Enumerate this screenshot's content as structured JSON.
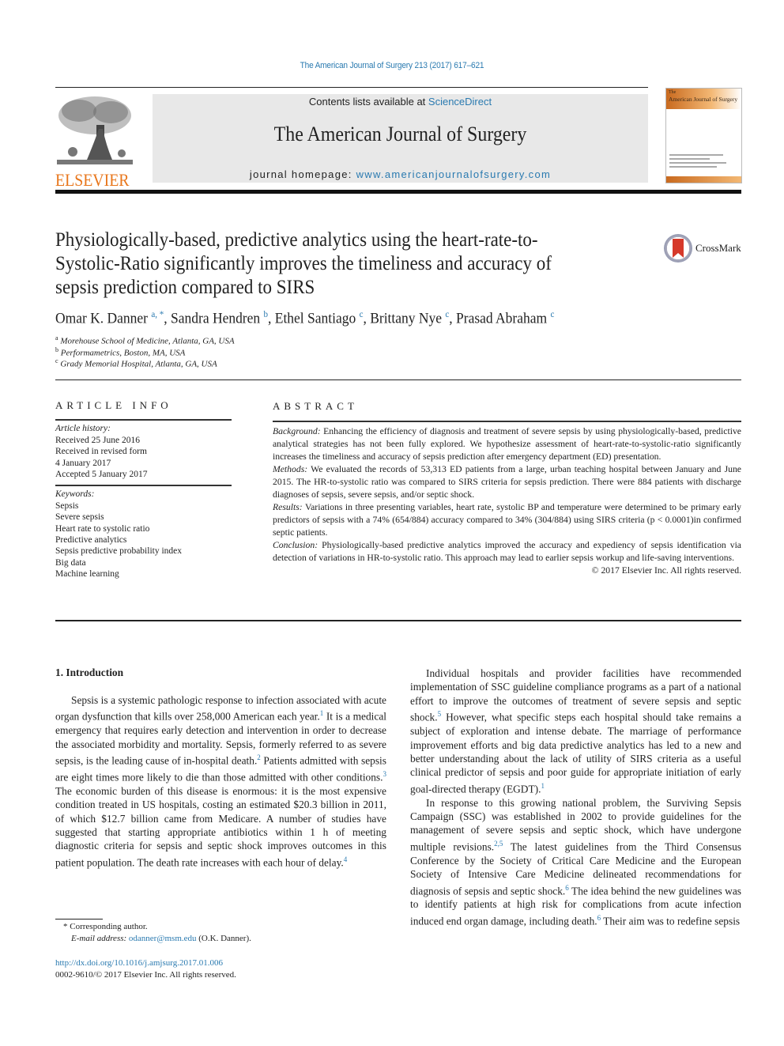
{
  "header": {
    "running_head": "The American Journal of Surgery 213 (2017) 617–621",
    "publisher_logo_text": "ELSEVIER",
    "contents_prefix": "Contents lists available at ",
    "contents_link": "ScienceDirect",
    "journal_name": "The American Journal of Surgery",
    "homepage_prefix": "journal homepage: ",
    "homepage_link": "www.americanjournalofsurgery.com",
    "cover_title_small": "The",
    "cover_title": "American Journal of Surgery",
    "crossmark_label": "CrossMark",
    "brand_color": "#e8751a",
    "link_color": "#2a7ab0"
  },
  "article": {
    "title_lines": [
      "Physiologically-based, predictive analytics using the heart-rate-to-",
      "Systolic-Ratio significantly improves the timeliness and accuracy of",
      "sepsis prediction compared to SIRS"
    ],
    "authors": [
      {
        "name": "Omar K. Danner",
        "sup": "a, *"
      },
      {
        "name": "Sandra Hendren",
        "sup": "b"
      },
      {
        "name": "Ethel Santiago",
        "sup": "c"
      },
      {
        "name": "Brittany Nye",
        "sup": "c"
      },
      {
        "name": "Prasad Abraham",
        "sup": "c"
      }
    ],
    "affiliations": [
      {
        "sup": "a",
        "text": "Morehouse School of Medicine, Atlanta, GA, USA"
      },
      {
        "sup": "b",
        "text": "Performametrics, Boston, MA, USA"
      },
      {
        "sup": "c",
        "text": "Grady Memorial Hospital, Atlanta, GA, USA"
      }
    ]
  },
  "article_info": {
    "heading": "ARTICLE INFO",
    "history_label": "Article history:",
    "history": [
      "Received 25 June 2016",
      "Received in revised form",
      "4 January 2017",
      "Accepted 5 January 2017"
    ],
    "keywords_label": "Keywords:",
    "keywords": [
      "Sepsis",
      "Severe sepsis",
      "Heart rate to systolic ratio",
      "Predictive analytics",
      "Sepsis predictive probability index",
      "Big data",
      "Machine learning"
    ]
  },
  "abstract": {
    "heading": "ABSTRACT",
    "sections": [
      {
        "label": "Background:",
        "text": " Enhancing the efficiency of diagnosis and treatment of severe sepsis by using physiologically-based, predictive analytical strategies has not been fully explored. We hypothesize assessment of heart-rate-to-systolic-ratio significantly increases the timeliness and accuracy of sepsis prediction after emergency department (ED) presentation."
      },
      {
        "label": "Methods:",
        "text": "  We evaluated the records of 53,313 ED patients from a large, urban teaching hospital between January and June 2015. The HR-to-systolic ratio was compared to SIRS criteria for sepsis prediction. There were 884 patients with discharge diagnoses of sepsis, severe sepsis, and/or septic shock."
      },
      {
        "label": "Results:",
        "text": " Variations in three presenting variables, heart rate, systolic BP and temperature were determined to be primary early predictors of sepsis with a 74% (654/884) accuracy compared to 34% (304/884) using SIRS criteria (p < 0.0001)in confirmed septic patients."
      },
      {
        "label": "Conclusion:",
        "text": "  Physiologically-based predictive analytics improved the accuracy and expediency of sepsis identification via detection of variations in HR-to-systolic ratio. This approach may lead to earlier sepsis workup and life-saving interventions."
      }
    ],
    "copyright": "© 2017 Elsevier Inc. All rights reserved."
  },
  "body": {
    "intro_heading": "1.  Introduction",
    "left_paragraph": [
      {
        "t": "Sepsis is a systemic pathologic response to infection associated with acute organ dysfunction that kills over 258,000 American each year."
      },
      {
        "ref": "1"
      },
      {
        "t": " It is a medical emergency that requires early detection and intervention in order to decrease the associated morbidity and mortality. Sepsis, formerly referred to as severe sepsis, is the leading cause of in-hospital death."
      },
      {
        "ref": "2"
      },
      {
        "t": " Patients admitted with sepsis are eight times more likely to die than those admitted with other conditions."
      },
      {
        "ref": "3"
      },
      {
        "t": " The economic burden of this disease is enormous: it is the most expensive condition treated in US hospitals, costing an estimated $20.3 billion in 2011, of which $12.7 billion came from Medicare. A number of studies have suggested that starting appropriate antibiotics within 1 h of meeting diagnostic criteria for sepsis and septic shock improves outcomes in this patient population. The death rate increases with each hour of delay."
      },
      {
        "ref": "4"
      }
    ],
    "right_paragraph_1": [
      {
        "t": "Individual hospitals and provider facilities have recommended implementation of SSC guideline compliance programs as a part of a national effort to improve the outcomes of treatment of severe sepsis and septic shock."
      },
      {
        "ref": "5"
      },
      {
        "t": " However, what specific steps each hospital should take remains a subject of exploration and intense debate. The marriage of performance improvement efforts and big data predictive analytics has led to a new and better understanding about the lack of utility of SIRS criteria as a useful clinical predictor of sepsis and poor guide for appropriate initiation of early goal-directed therapy (EGDT)."
      },
      {
        "ref": "1"
      }
    ],
    "right_paragraph_2": [
      {
        "t": "In response to this growing national problem, the Surviving Sepsis Campaign (SSC) was established in 2002 to provide guidelines for the management of severe sepsis and septic shock, which have undergone multiple revisions."
      },
      {
        "ref": "2,5"
      },
      {
        "t": " The latest guidelines from the Third Consensus Conference by the Society of Critical Care Medicine and the European Society of Intensive Care Medicine delineated recommendations for diagnosis of sepsis and septic shock."
      },
      {
        "ref": "6"
      },
      {
        "t": " The idea behind the new guidelines was to identify patients at high risk for complications from acute infection induced end organ damage, including death."
      },
      {
        "ref": "6"
      },
      {
        "t": " Their aim was to redefine sepsis"
      }
    ]
  },
  "footer": {
    "corresponding": "*  Corresponding author.",
    "email_label": "E-mail address: ",
    "email": "odanner@msm.edu",
    "email_suffix": " (O.K. Danner).",
    "doi": "http://dx.doi.org/10.1016/j.amjsurg.2017.01.006",
    "issn_line": "0002-9610/© 2017 Elsevier Inc. All rights reserved."
  }
}
